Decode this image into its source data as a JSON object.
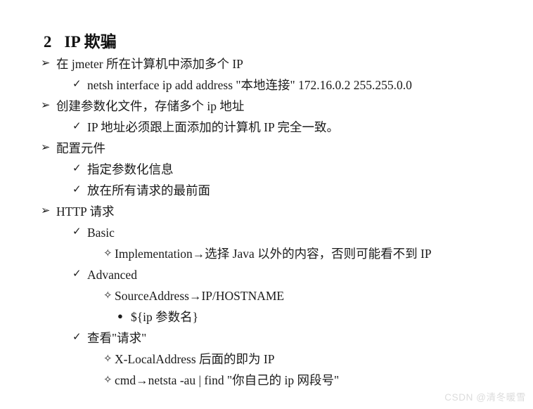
{
  "slide": {
    "title_number": "2",
    "title_text": "IP 欺骗",
    "background_color": "#ffffff",
    "text_color": "#1b1b1b"
  },
  "markers": {
    "level1": "➢",
    "level2": "✓",
    "level3": "✧",
    "level4": "●"
  },
  "outline": [
    {
      "level": 1,
      "marker": "➢",
      "text": "在 jmeter 所在计算机中添加多个 IP"
    },
    {
      "level": 2,
      "marker": "✓",
      "text": "netsh interface ip add address \"本地连接\" 172.16.0.2 255.255.0.0"
    },
    {
      "level": 1,
      "marker": "➢",
      "text": "创建参数化文件，存储多个 ip 地址"
    },
    {
      "level": 2,
      "marker": "✓",
      "text": "IP 地址必须跟上面添加的计算机 IP 完全一致。"
    },
    {
      "level": 1,
      "marker": "➢",
      "text": "配置元件"
    },
    {
      "level": 2,
      "marker": "✓",
      "text": "指定参数化信息"
    },
    {
      "level": 2,
      "marker": "✓",
      "text": "放在所有请求的最前面"
    },
    {
      "level": 1,
      "marker": "➢",
      "text": "HTTP 请求"
    },
    {
      "level": 2,
      "marker": "✓",
      "text": "Basic"
    },
    {
      "level": 3,
      "marker": "✧",
      "text": "Implementation→选择 Java 以外的内容，否则可能看不到 IP"
    },
    {
      "level": 2,
      "marker": "✓",
      "text": "Advanced"
    },
    {
      "level": 3,
      "marker": "✧",
      "text": "SourceAddress→IP/HOSTNAME"
    },
    {
      "level": 4,
      "marker": "●",
      "text": "${ip 参数名}"
    },
    {
      "level": 2,
      "marker": "✓",
      "text": "查看\"请求\""
    },
    {
      "level": 3,
      "marker": "✧",
      "text": "X-LocalAddress 后面的即为 IP"
    },
    {
      "level": 3,
      "marker": "✧",
      "text": "cmd→netsta -au | find \"你自己的 ip 网段号\""
    }
  ],
  "watermark": {
    "text": "CSDN @清冬暖雪",
    "color": "#dcdcdc"
  }
}
